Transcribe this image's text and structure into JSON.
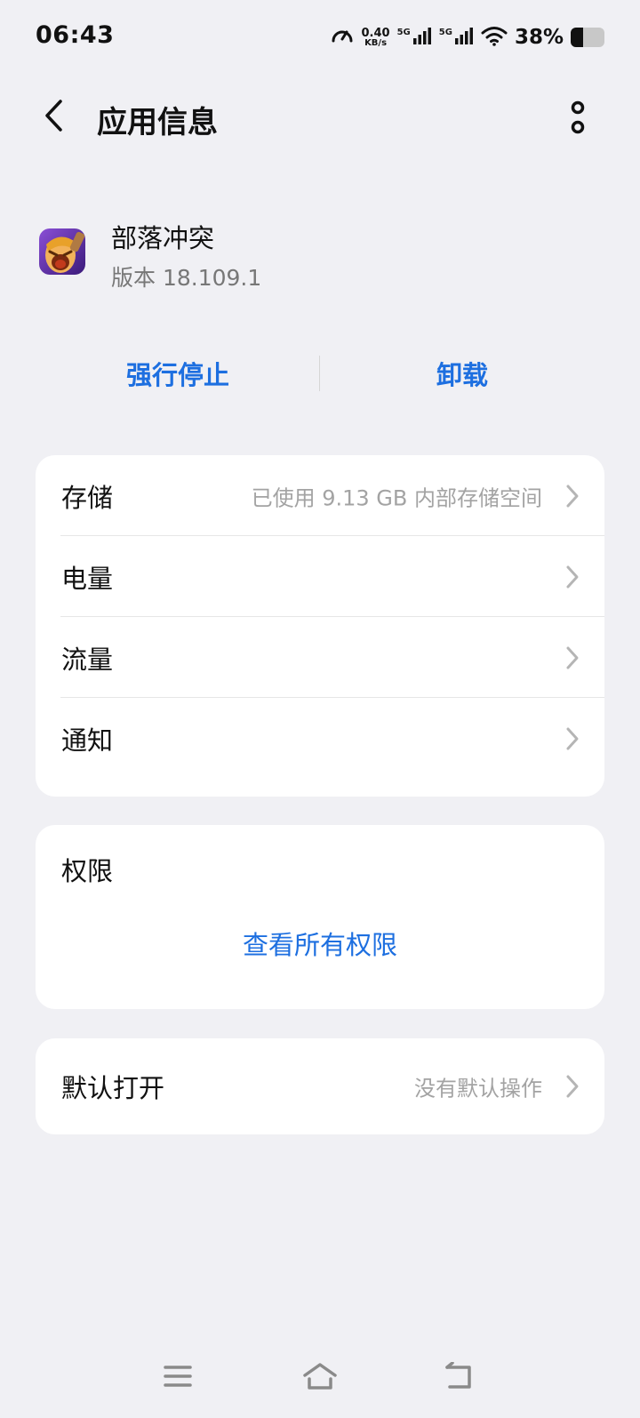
{
  "status_bar": {
    "time": "06:43",
    "net_speed_value": "0.40",
    "net_speed_unit": "KB/s",
    "sim1_tag": "5G",
    "sim2_tag": "5G",
    "battery_percent_text": "38%",
    "battery_level": 0.38,
    "icons": [
      "speedometer-icon",
      "signal-icon",
      "signal-icon",
      "wifi-icon",
      "battery-icon"
    ]
  },
  "header": {
    "title": "应用信息",
    "back_icon": "chevron-left-icon",
    "more_icon": "more-vertical-icon"
  },
  "app": {
    "name": "部落冲突",
    "version": "版本 18.109.1"
  },
  "actions": {
    "force_stop": "强行停止",
    "uninstall": "卸载"
  },
  "settings": [
    {
      "label": "存储",
      "value": "已使用 9.13 GB 内部存储空间"
    },
    {
      "label": "电量",
      "value": ""
    },
    {
      "label": "流量",
      "value": ""
    },
    {
      "label": "通知",
      "value": ""
    }
  ],
  "permissions": {
    "title": "权限",
    "link": "查看所有权限"
  },
  "default_open": {
    "label": "默认打开",
    "value": "没有默认操作"
  },
  "nav": {
    "icons": [
      "menu-icon",
      "home-icon",
      "back-icon"
    ]
  },
  "colors": {
    "accent": "#1d6fe0",
    "background": "#f0f0f4",
    "card": "#ffffff",
    "secondary_text": "#a3a3a3"
  }
}
